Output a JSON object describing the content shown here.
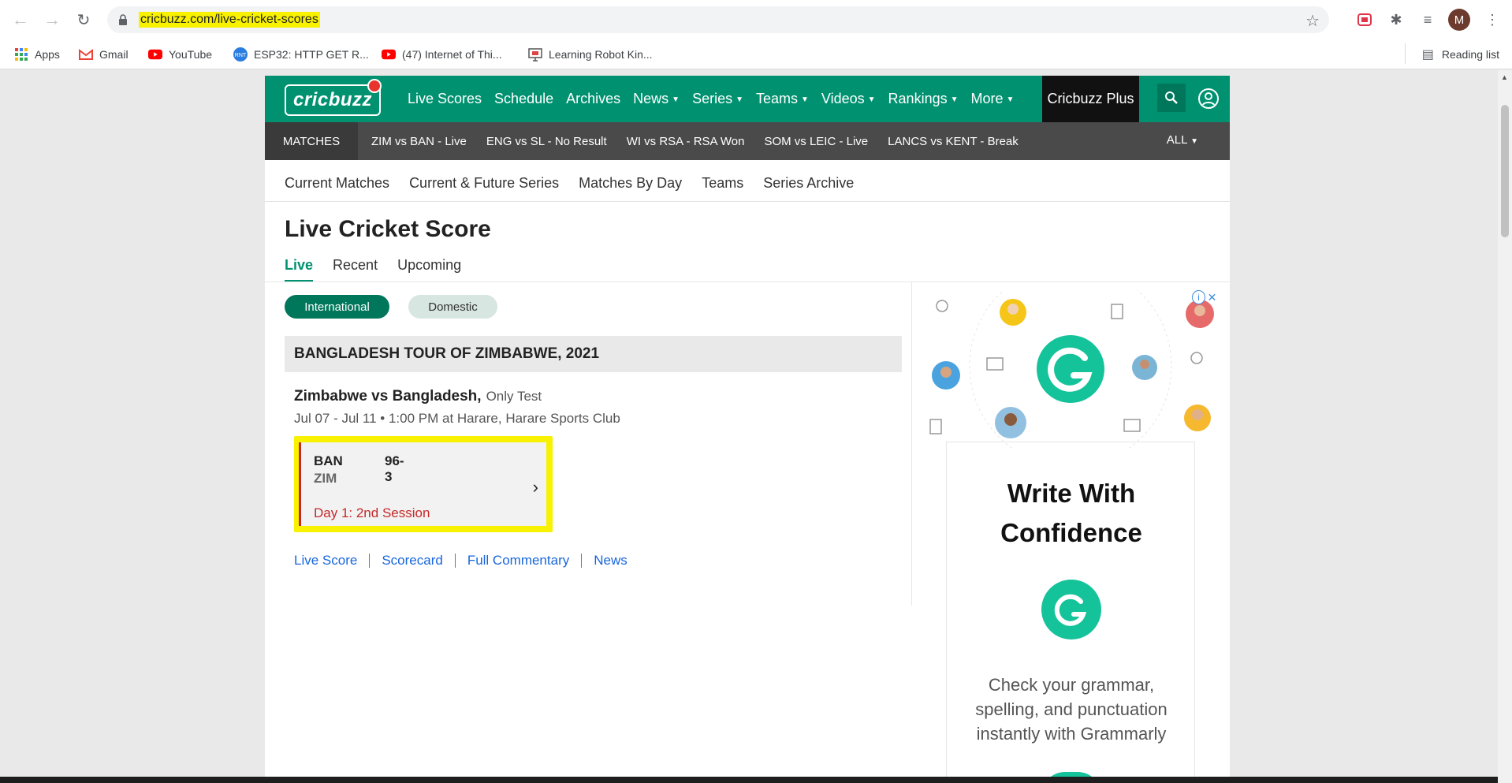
{
  "browser": {
    "url": "cricbuzz.com/live-cricket-scores",
    "bookmarks": [
      "Apps",
      "Gmail",
      "YouTube",
      "ESP32: HTTP GET R...",
      "(47) Internet of Thi...",
      "Learning Robot Kin..."
    ],
    "reading_list": "Reading list",
    "avatar_letter": "M"
  },
  "site": {
    "logo": "cricbuzz",
    "nav": [
      "Live Scores",
      "Schedule",
      "Archives",
      "News",
      "Series",
      "Teams",
      "Videos",
      "Rankings",
      "More"
    ],
    "plus": "Cricbuzz Plus",
    "matches_label": "MATCHES",
    "match_links": [
      "ZIM vs BAN - Live",
      "ENG vs SL - No Result",
      "WI vs RSA - RSA Won",
      "SOM vs LEIC - Live",
      "LANCS vs KENT - Break"
    ],
    "all_label": "ALL",
    "subnav": [
      "Current Matches",
      "Current & Future Series",
      "Matches By Day",
      "Teams",
      "Series Archive"
    ]
  },
  "main": {
    "title": "Live Cricket Score",
    "tabs": [
      "Live",
      "Recent",
      "Upcoming"
    ],
    "filters": [
      "International",
      "Domestic"
    ],
    "series": "BANGLADESH TOUR OF ZIMBABWE, 2021",
    "match": {
      "title": "Zimbabwe vs Bangladesh,",
      "type": "Only Test",
      "info": "Jul 07 - Jul 11  •  1:00 PM at Harare, Harare Sports Club",
      "team1": "BAN",
      "score1": "96-3",
      "team2": "ZIM",
      "status": "Day 1: 2nd Session"
    },
    "links": [
      "Live Score",
      "Scorecard",
      "Full Commentary",
      "News"
    ]
  },
  "ad": {
    "headline_1": "Write With",
    "headline_2": "Confidence",
    "body_1": "Check your grammar,",
    "body_2": "spelling, and punctuation",
    "body_3": "instantly with Grammarly"
  },
  "colors": {
    "brand_green": "#009270",
    "highlight_yellow": "#f8f200",
    "live_red": "#c62828",
    "link_blue": "#1866db",
    "grammarly_green": "#15c39a"
  }
}
